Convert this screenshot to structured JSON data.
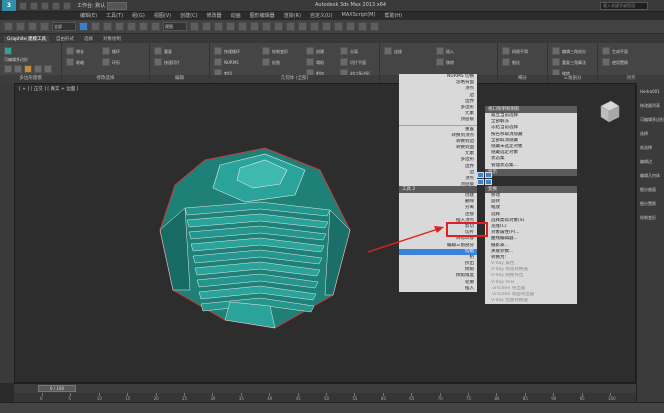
{
  "app": {
    "icon_text": "3",
    "workspace_label": "工作台: 默认",
    "window_title": "Autodesk 3ds Max 2013 x64",
    "search_placeholder": "键入关键字或短语"
  },
  "menubar": [
    "编辑(E)",
    "工具(T)",
    "组(G)",
    "视图(V)",
    "创建(C)",
    "修改器",
    "动画",
    "图形编辑器",
    "渲染(R)",
    "自定义(U)",
    "MAXScript(M)",
    "帮助(H)"
  ],
  "toolbar": {
    "selection_filter": "全部",
    "view_select": "视图"
  },
  "ribbon_tabs": [
    "Graphite 建模工具",
    "自由形式",
    "选择",
    "对象绘制"
  ],
  "ribbon": {
    "panel1_title": "多边形建模",
    "panel2_title": "修改选择",
    "panel3_title": "编辑",
    "panel4_title": "几何体 (全部)",
    "panel5_title": "循环",
    "panel6_title": "细分",
    "panel7_title": "三角剖分",
    "panel8_title": "对齐",
    "btn_edit_poly": "可编辑多边形",
    "btn_grow": "增长",
    "btn_shrink": "收缩",
    "btn_loop": "循环",
    "btn_ring": "环形",
    "btn_repeat": "重复",
    "btn_quickslice": "快速切片",
    "btn_quickloop": "快速循环",
    "btn_nurms": "NURMS",
    "btn_cut": "剪切",
    "btn_paint": "绘制变形",
    "btn_relax": "松弛",
    "btn_create": "创建",
    "btn_collapse": "塌陷",
    "btn_attach": "附加",
    "btn_detach": "分离",
    "btn_slice_plane": "切片平面",
    "btn_cap": "封口多边形",
    "btn_connect": "连接",
    "btn_insert": "插入",
    "btn_remove": "移除",
    "btn_mesh_smooth": "网格平滑",
    "btn_tessellate": "细化",
    "btn_edit_tri": "编辑三角剖分",
    "btn_retri": "重复三角算法",
    "btn_turn": "旋转",
    "btn_generate": "生成平面",
    "btn_use_displacement": "使用置换"
  },
  "viewport": {
    "label": "[ + ] [ 正交 ] [ 真实 + 边面 ]"
  },
  "quad_menu": {
    "top_left": [
      "孤立当前选择",
      "全部解冻",
      "冻结当前选择",
      "按名称取消隐藏",
      "全部取消隐藏",
      "隐藏未选定对象",
      "隐藏选定对象",
      "状态集",
      "管理状态集..."
    ],
    "tools1_header": "工具 1",
    "tools2_header": "工具 2",
    "left_head_label": "视口照明和阴影",
    "top_left_items": [
      "NURMS 切换",
      "忽略背面",
      "顶点",
      "边",
      "边界",
      "多边形",
      "元素",
      "顶层级"
    ],
    "left_mid": [
      "重置",
      "转换到顶点",
      "转换到边",
      "转换到面",
      "元素",
      "多边形",
      "边界",
      "边",
      "顶点",
      "顶层级"
    ],
    "display_header": "显示",
    "transform_header": "变换",
    "bottom_left": [
      "创建",
      "删除",
      "分离",
      "连接",
      "插入顶点",
      "剪切",
      "切片",
      "目标焊接",
      "编辑三角剖分",
      "切角",
      "桥",
      "挤出",
      "倒角",
      "倒角角度",
      "轮廓",
      "插入"
    ],
    "bottom_right": [
      "移动",
      "旋转",
      "缩放",
      "选择",
      "选择类似对象(S)",
      "克隆(C)",
      "对象属性(P)...",
      "曲线编辑器...",
      "摄影表...",
      "关联参数...",
      "转换为:",
      "V-Ray 属性",
      "V-Ray 场景转换器",
      "V-Ray 网格导出",
      "V-Ray VFB",
      ".vrscene 导出器",
      ".vrscene 动画导出器",
      "V-Ray 位图转换器"
    ],
    "highlight_item": "切角"
  },
  "right_panel": {
    "items": [
      "Hedra001",
      "修改器列表",
      "可编辑多边形",
      "选择",
      "软选择",
      "编辑边",
      "编辑几何体",
      "细分曲面",
      "细分置换",
      "绘制变形"
    ]
  },
  "timeline": {
    "slider": "0 / 100",
    "ticks": [
      "0",
      "5",
      "10",
      "15",
      "20",
      "25",
      "30",
      "35",
      "40",
      "45",
      "50",
      "55",
      "60",
      "65",
      "70",
      "75",
      "80",
      "85",
      "90",
      "95",
      "100"
    ]
  },
  "colors": {
    "mesh_face": "#2aa39a",
    "mesh_edge": "#e8e8e8",
    "highlight": "#3b83d8",
    "red_annotation": "#e02020"
  }
}
